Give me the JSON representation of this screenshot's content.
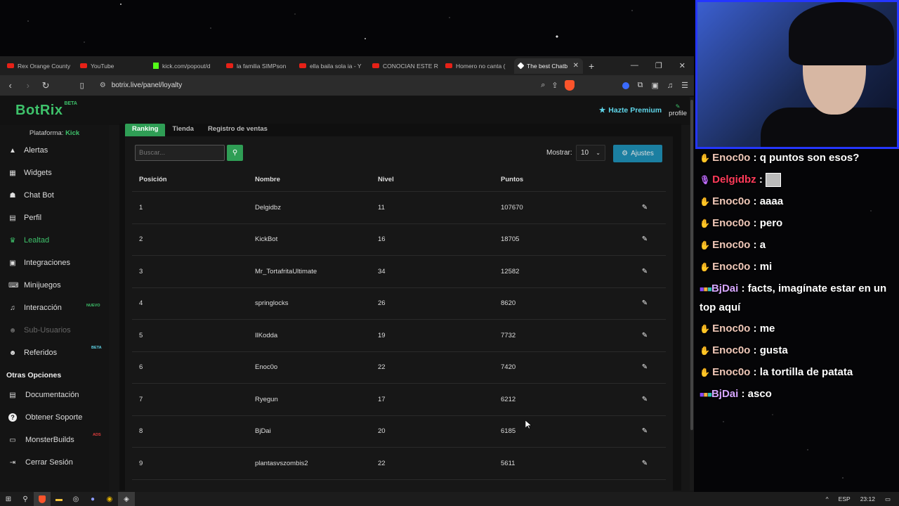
{
  "browser": {
    "tabs": [
      {
        "label": "Rex Orange County",
        "fav": "youtube"
      },
      {
        "label": "YouTube",
        "fav": "youtube"
      },
      {
        "label": "kick.com/popout/d",
        "fav": "kick"
      },
      {
        "label": "la familia SIMPson",
        "fav": "youtube"
      },
      {
        "label": "ella baila sola ia - Y",
        "fav": "youtube"
      },
      {
        "label": "CONOCIAN ESTE R",
        "fav": "youtube"
      },
      {
        "label": "Homero no canta (",
        "fav": "youtube"
      }
    ],
    "active_tab": "The best Chatb",
    "url": "botrix.live/panel/loyalty"
  },
  "app": {
    "logo": "BotRix",
    "logo_badge": "BETA",
    "premium_label": "Hazte Premium",
    "profile_label": "profile",
    "platform_prefix": "Plataforma:",
    "platform_value": "Kick"
  },
  "sidebar": {
    "items": [
      {
        "label": "Alertas",
        "icon": "warning-icon"
      },
      {
        "label": "Widgets",
        "icon": "widgets-icon"
      },
      {
        "label": "Chat Bot",
        "icon": "robot-icon"
      },
      {
        "label": "Perfil",
        "icon": "profile-card-icon"
      },
      {
        "label": "Lealtad",
        "icon": "trophy-icon"
      },
      {
        "label": "Integraciones",
        "icon": "integrations-icon"
      },
      {
        "label": "Minijuegos",
        "icon": "gamepad-icon"
      },
      {
        "label": "Interacción",
        "icon": "music-icon",
        "badge": "NUEVO"
      },
      {
        "label": "Sub-Usuarios",
        "icon": "users-icon"
      },
      {
        "label": "Referidos",
        "icon": "referrals-icon",
        "badge": "BETA"
      }
    ],
    "section_title": "Otras Opciones",
    "options": [
      {
        "label": "Documentación",
        "icon": "document-icon"
      },
      {
        "label": "Obtener Soporte",
        "icon": "help-icon"
      },
      {
        "label": "MonsterBuilds",
        "icon": "monitor-icon",
        "badge": "ADS"
      },
      {
        "label": "Cerrar Sesión",
        "icon": "logout-icon"
      }
    ]
  },
  "loyalty": {
    "tabs": [
      "Ranking",
      "Tienda",
      "Registro de ventas"
    ],
    "search_placeholder": "Buscar...",
    "show_label": "Mostrar:",
    "show_value": "10",
    "settings_label": "Ajustes",
    "columns": [
      "Posición",
      "Nombre",
      "Nivel",
      "Puntos"
    ],
    "rows": [
      {
        "pos": "1",
        "name": "Delgidbz",
        "level": "11",
        "points": "107670"
      },
      {
        "pos": "2",
        "name": "KickBot",
        "level": "16",
        "points": "18705"
      },
      {
        "pos": "3",
        "name": "Mr_TortafritaUltimate",
        "level": "34",
        "points": "12582"
      },
      {
        "pos": "4",
        "name": "springlocks",
        "level": "26",
        "points": "8620"
      },
      {
        "pos": "5",
        "name": "IlKodda",
        "level": "19",
        "points": "7732"
      },
      {
        "pos": "6",
        "name": "Enoc0o",
        "level": "22",
        "points": "7420"
      },
      {
        "pos": "7",
        "name": "Ryegun",
        "level": "17",
        "points": "6212"
      },
      {
        "pos": "8",
        "name": "BjDai",
        "level": "20",
        "points": "6185"
      },
      {
        "pos": "9",
        "name": "plantasvszombis2",
        "level": "22",
        "points": "5611"
      }
    ]
  },
  "chat": [
    {
      "user": "Enoc0o",
      "color": "u-enoc",
      "text": "q puntos son esos?"
    },
    {
      "user": "Delgidbz",
      "color": "u-delg",
      "text": ""
    },
    {
      "user": "Enoc0o",
      "color": "u-enoc",
      "text": "aaaa"
    },
    {
      "user": "Enoc0o",
      "color": "u-enoc",
      "text": "pero"
    },
    {
      "user": "Enoc0o",
      "color": "u-enoc",
      "text": "a"
    },
    {
      "user": "Enoc0o",
      "color": "u-enoc",
      "text": "mi"
    },
    {
      "user": "BjDai",
      "color": "u-bjd",
      "text": "facts, imagínate estar en un top aquí"
    },
    {
      "user": "Enoc0o",
      "color": "u-enoc",
      "text": "me"
    },
    {
      "user": "Enoc0o",
      "color": "u-enoc",
      "text": "gusta"
    },
    {
      "user": "Enoc0o",
      "color": "u-enoc",
      "text": "la tortilla de patata"
    },
    {
      "user": "BjDai",
      "color": "u-bjd",
      "text": "asco"
    }
  ],
  "taskbar": {
    "lang": "ESP",
    "time": "23:12"
  },
  "colors": {
    "accent_green": "#3ec26b",
    "tab_green": "#2f9e55",
    "settings_blue": "#1b7fa1",
    "premium_cyan": "#5fd6ea",
    "cam_border": "#2436ff"
  }
}
